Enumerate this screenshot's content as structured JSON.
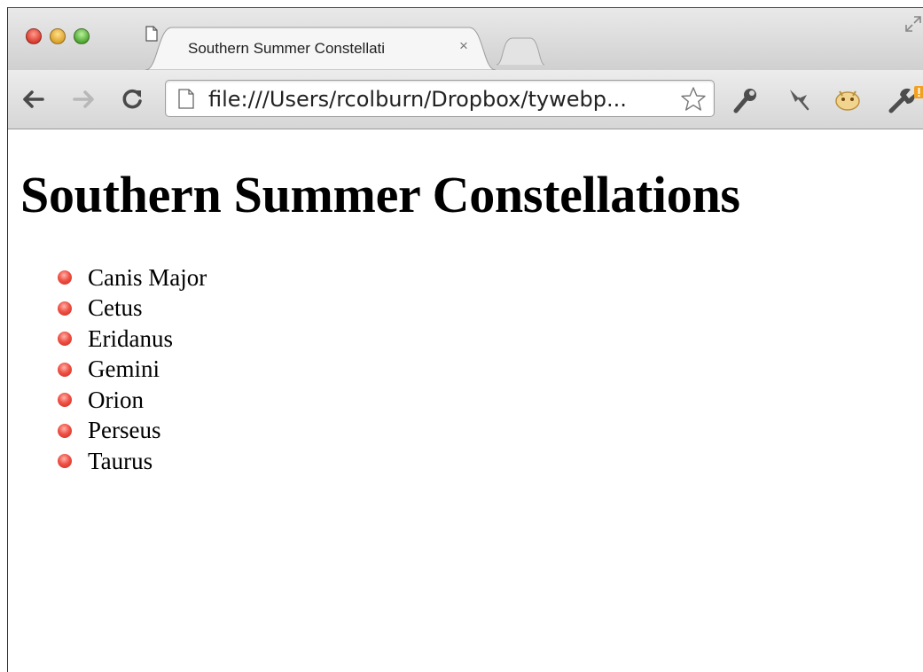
{
  "browser": {
    "tab": {
      "title": "Southern Summer Constellati",
      "close_label": "×"
    },
    "address": {
      "url": "file:///Users/rcolburn/Dropbox/tywebp..."
    },
    "icons": [
      "back-arrow-icon",
      "forward-arrow-icon",
      "reload-icon",
      "document-icon",
      "bookmark-star-icon",
      "tools-icon",
      "pin-icon",
      "extension-icon",
      "wrench-menu-icon",
      "fullscreen-icon"
    ]
  },
  "page": {
    "heading": "Southern Summer Constellations",
    "constellations": [
      "Canis Major",
      "Cetus",
      "Eridanus",
      "Gemini",
      "Orion",
      "Perseus",
      "Taurus"
    ]
  },
  "colors": {
    "bullet": "#e8433a",
    "traffic_close": "#d83a2c",
    "traffic_min": "#dca12a",
    "traffic_max": "#4ea531"
  }
}
